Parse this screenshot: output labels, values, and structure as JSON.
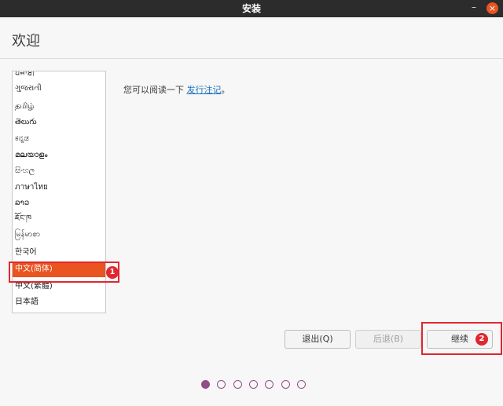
{
  "window": {
    "title": "安装",
    "minimize_glyph": "–",
    "close_glyph": "×"
  },
  "header": {
    "title": "欢迎"
  },
  "languages": {
    "items": [
      "ਪੰਜਾਬੀ",
      "ગુજરાતી",
      "தமிழ்",
      "తెలుగు",
      "ಕನ್ನಡ",
      "മലയാളം",
      "සිංහල",
      "ภาษาไทย",
      "ລາວ",
      "ཇོང་ཁ",
      "မြန်မာစာ",
      "한국어",
      "中文(简体)",
      "中文(繁體)",
      "日本語"
    ],
    "selected": "中文(简体)"
  },
  "notes": {
    "prefix": "您可以阅读一下 ",
    "link": "发行注记",
    "suffix": "。"
  },
  "buttons": {
    "quit": "退出(Q)",
    "back": "后退(B)",
    "continue": "继续"
  },
  "annotations": {
    "badge1": "1",
    "badge2": "2"
  },
  "pager": {
    "total": 7,
    "current": 1
  },
  "colors": {
    "accent": "#e95420",
    "annotation": "#e0272f",
    "dot": "#924d8b",
    "link": "#1a74c0"
  }
}
